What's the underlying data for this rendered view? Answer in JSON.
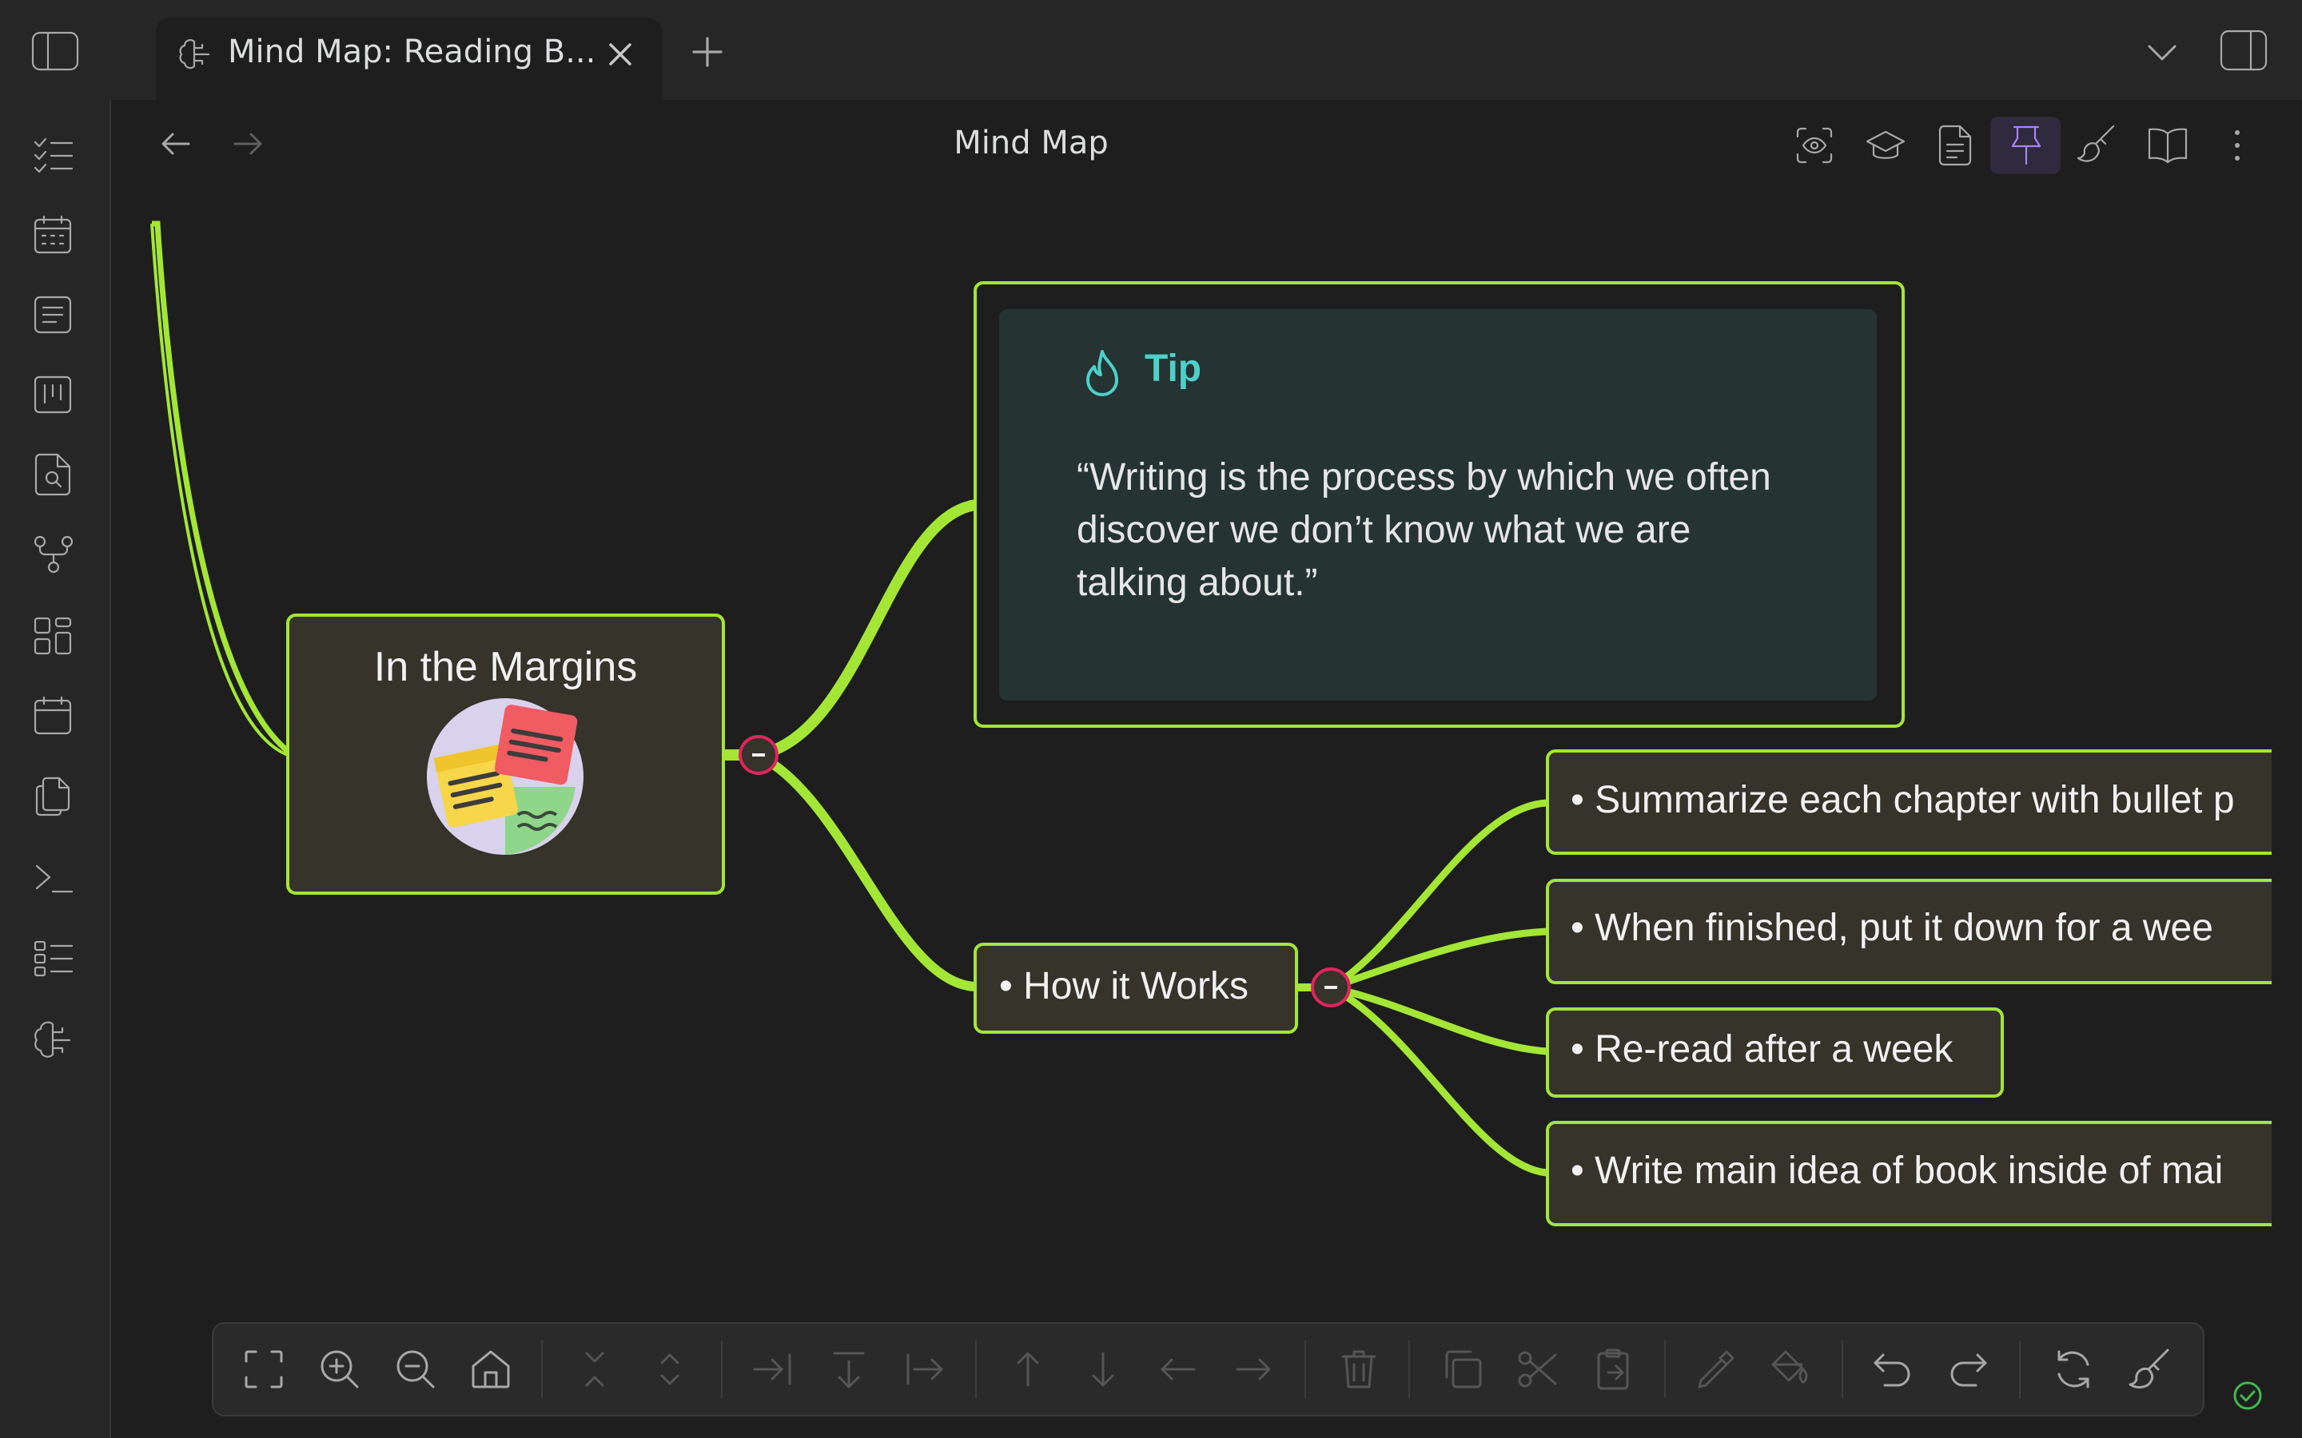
{
  "tab": {
    "title": "Mind Map: Reading B...",
    "icon": "brain-icon"
  },
  "header": {
    "title": "Mind Map"
  },
  "mindmap": {
    "root": {
      "title": "In the Margins",
      "image": "sticky-notes-illustration"
    },
    "tip": {
      "label": "Tip",
      "icon": "flame-icon",
      "quote_lines": [
        "“Writing is the process by which we often",
        "discover we don’t know what we are",
        "talking about.”"
      ]
    },
    "how_it_works": {
      "label": "• How it Works"
    },
    "steps": [
      "• Summarize each chapter with bullet p",
      "• When finished, put it down for a wee",
      "• Re-read after a week",
      "• Write main idea of book inside of mai"
    ]
  },
  "colors": {
    "accent": "#a3e635",
    "collapse_border": "#e0245e",
    "tip_title": "#4dd0c9",
    "pin_active": "#a882ff"
  },
  "toolbar_icons": [
    "fit-screen-icon",
    "zoom-in-icon",
    "zoom-out-icon",
    "home-icon",
    "collapse-all-icon",
    "expand-all-icon",
    "add-child-icon",
    "add-sibling-below-icon",
    "add-sibling-icon",
    "move-up-icon",
    "move-down-icon",
    "move-left-icon",
    "move-right-icon",
    "delete-icon",
    "copy-icon",
    "cut-icon",
    "paste-icon",
    "pick-color-icon",
    "fill-color-icon",
    "undo-icon",
    "redo-icon",
    "refresh-icon",
    "theme-brush-icon"
  ]
}
